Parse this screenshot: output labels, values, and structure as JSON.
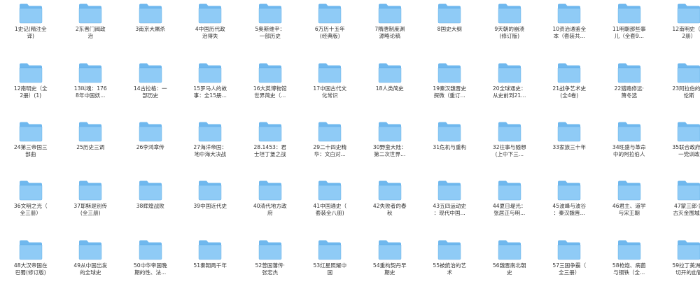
{
  "colors": {
    "folder_back": "#6FB8EE",
    "folder_front": "#8FCBF6",
    "folder_edge": "#5AA6E0"
  },
  "items": [
    {
      "label": "1史记(精注全\n译)"
    },
    {
      "label": "2东晋门阀政\n治"
    },
    {
      "label": "3南京大屠杀"
    },
    {
      "label": "4中国历代政\n治得失"
    },
    {
      "label": "5奥斯维辛：\n一部历史"
    },
    {
      "label": "6万历十五年\n(经典版)"
    },
    {
      "label": "7隋唐制度渊\n源略论稿"
    },
    {
      "label": "8国史大纲"
    },
    {
      "label": "9天朝的崩溃\n(修订版)"
    },
    {
      "label": "10资治通鉴全\n本（套装共..."
    },
    {
      "label": "11明朝那些事\n儿（全套9..."
    },
    {
      "label": "12南明史（全\n2册）"
    },
    {
      "label": "12南明史（全\n2册）(1)"
    },
    {
      "label": "13叫魂：176\n8年中国妖..."
    },
    {
      "label": "14古拉格：一\n部历史"
    },
    {
      "label": "15罗马人的故\n事：全15册..."
    },
    {
      "label": "16大英博物馆\n世界简史（..."
    },
    {
      "label": "17中国古代文\n化常识"
    },
    {
      "label": "18人类简史"
    },
    {
      "label": "19秦汉魏晋史\n探微（重订..."
    },
    {
      "label": "20全球通史：\n从史前到21..."
    },
    {
      "label": "21战争艺术史\n(全4卷)"
    },
    {
      "label": "22猎路修远·\n萧冬选"
    },
    {
      "label": "23阿拉伯的劳\n伦斯"
    },
    {
      "label": "24第三帝国三\n部曲"
    },
    {
      "label": "25历史三调"
    },
    {
      "label": "26李鸿章传"
    },
    {
      "label": "27海洋帝国：\n地中海大决战"
    },
    {
      "label": "28.1453：君\n士坦丁堡之战"
    },
    {
      "label": "29二十四史精\n华：文白对..."
    },
    {
      "label": "30野蛮大陆：\n第二次世界..."
    },
    {
      "label": "31危机与重构"
    },
    {
      "label": "32往事与随想\n(上中下三..."
    },
    {
      "label": "33家族三十年"
    },
    {
      "label": "34旺盛与革命\n中的阿拉伯人"
    },
    {
      "label": "35联合政府与\n一党训政"
    },
    {
      "label": "36文明之光（\n全三册）"
    },
    {
      "label": "37耶稣是别传\n(全三册)"
    },
    {
      "label": "38辉煌战败"
    },
    {
      "label": "39中国近代史"
    },
    {
      "label": "40清代地方政\n府"
    },
    {
      "label": "41中国通史（\n套装全八册)"
    },
    {
      "label": "42失败者的春\n秋"
    },
    {
      "label": "43五四运动史\n：现代中国..."
    },
    {
      "label": "44夏日堤光：\n张居正与明..."
    },
    {
      "label": "45波峰与波谷\n：秦汉魏晋..."
    },
    {
      "label": "46君主、道学\n与宋王朝"
    },
    {
      "label": "47蒙三郎·蒙\n古灭金围城史"
    },
    {
      "label": "48大汉帝国在\n巴蜀(修订版)"
    },
    {
      "label": "49从中国出发\n的全球史"
    },
    {
      "label": "50中华帝国晚\n期的性、法..."
    },
    {
      "label": "51秦朝两千年"
    },
    {
      "label": "52曾国藩传·\n张宏杰"
    },
    {
      "label": "53红星照耀中\n国"
    },
    {
      "label": "54重构契丹早\n期史"
    },
    {
      "label": "55被统治的艺\n术"
    },
    {
      "label": "56魏晋南北朝\n史"
    },
    {
      "label": "57三国争霸（\n全三册）"
    },
    {
      "label": "58枪炮、病菌\n与钢铁（全..."
    },
    {
      "label": "59拉丁美洲被\n切开的血管"
    }
  ]
}
